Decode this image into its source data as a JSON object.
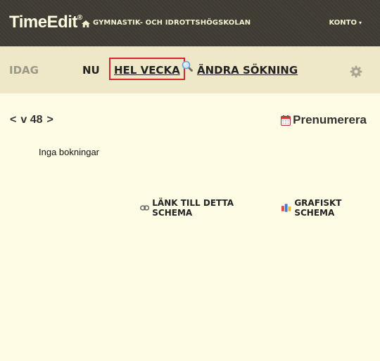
{
  "header": {
    "logo_main": "TimeEdit",
    "logo_mark": "®",
    "school_name": "GYMNASTIK- OCH IDROTTSHÖGSKOLAN",
    "account_label": "KONTO",
    "account_caret": "▾"
  },
  "nav": {
    "today": "IDAG",
    "now": "NU",
    "whole_week": "HEL VECKA",
    "change_search": "ÄNDRA SÖKNING"
  },
  "schedule": {
    "prev": "<",
    "week": "v 48",
    "next": ">",
    "subscribe": "Prenumerera",
    "empty_message": "Inga bokningar",
    "link_label": "LÄNK TILL DETTA SCHEMA",
    "graphic_label": "GRAFISKT SCHEMA"
  },
  "colors": {
    "header_bg": "#3f3c34",
    "nav_bg": "#efe8c8",
    "content_bg": "#fffce5",
    "highlight_border": "#d5242c"
  }
}
